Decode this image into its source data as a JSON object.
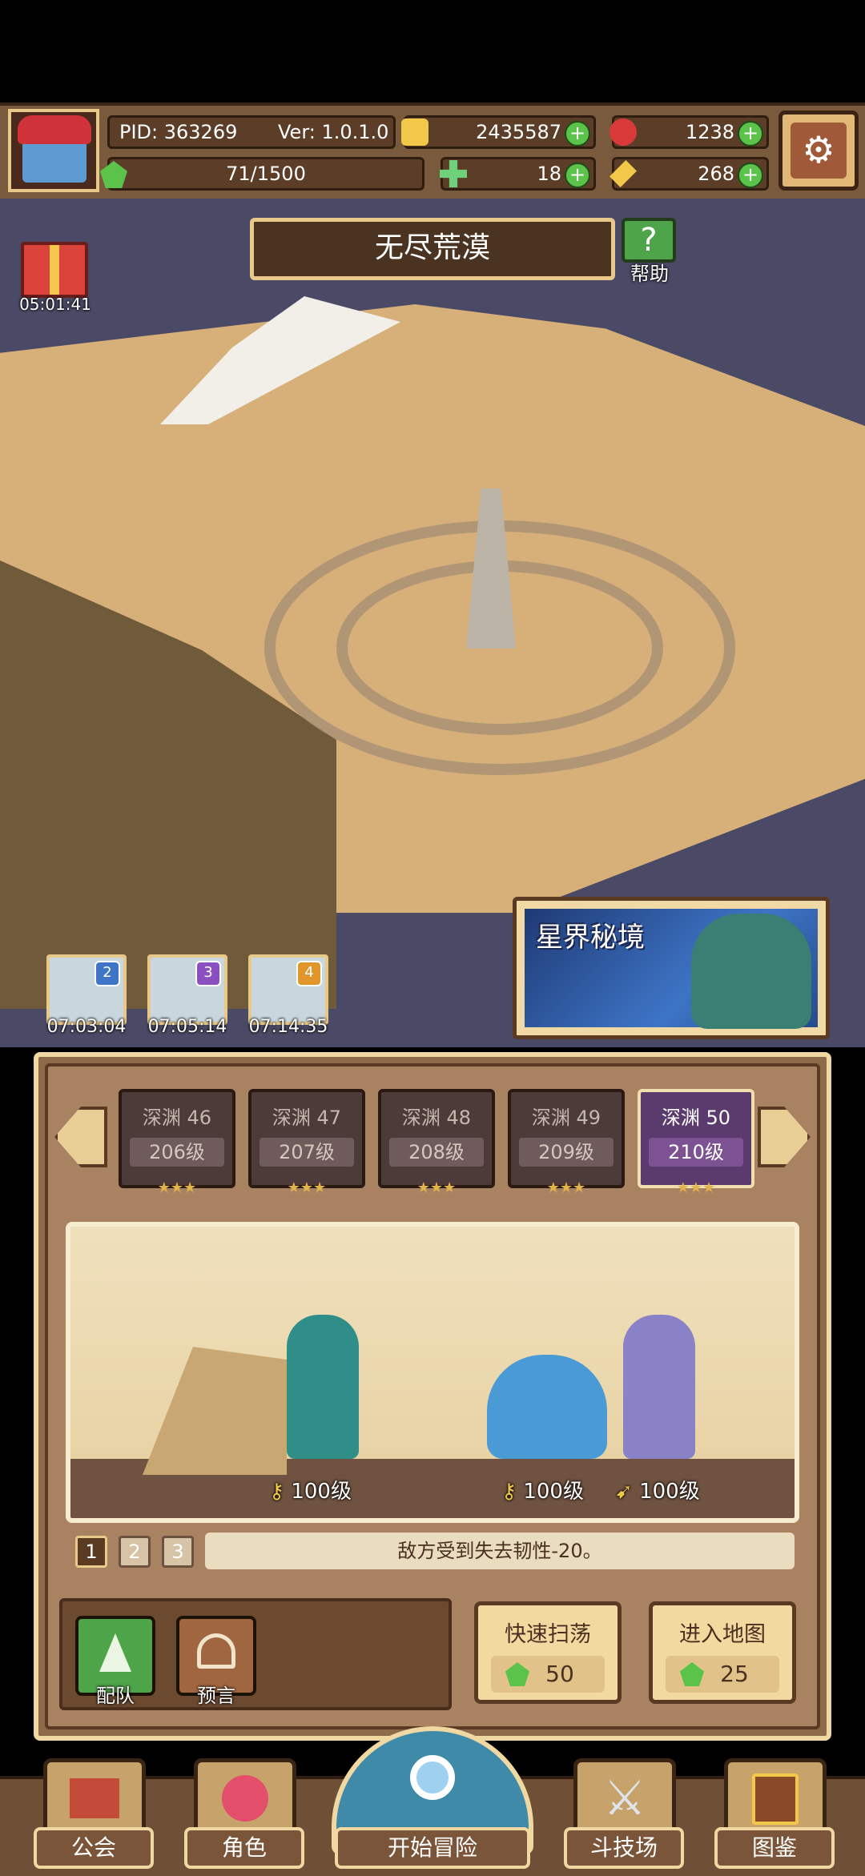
{
  "header": {
    "pid": "PID: 363269",
    "version": "Ver: 1.0.1.0",
    "gold": "2435587",
    "ruby": "1238",
    "stamina": "71/1500",
    "clover": "18",
    "key": "268"
  },
  "map": {
    "title": "无尽荒漠",
    "help_label": "帮助",
    "gift_timer": "05:01:41"
  },
  "expedition_slots": [
    {
      "num": "2",
      "time": "07:03:04"
    },
    {
      "num": "3",
      "time": "07:05:14"
    },
    {
      "num": "4",
      "time": "07:14:35"
    }
  ],
  "astral": {
    "label": "星界秘境"
  },
  "stages": [
    {
      "name": "深渊 46",
      "level": "206级",
      "stars": "★★★"
    },
    {
      "name": "深渊 47",
      "level": "207级",
      "stars": "★★★"
    },
    {
      "name": "深渊 48",
      "level": "208级",
      "stars": "★★★"
    },
    {
      "name": "深渊 49",
      "level": "209级",
      "stars": "★★★"
    },
    {
      "name": "深渊 50",
      "level": "210级",
      "stars": "★★★"
    }
  ],
  "battle": {
    "ally_level": "100级",
    "enemy_level_1": "100级",
    "enemy_level_2": "100级"
  },
  "effect": {
    "tabs": [
      "1",
      "2",
      "3"
    ],
    "text": "敌方受到失去韧性-20。"
  },
  "actions": {
    "team_label": "配队",
    "prophecy_label": "预言",
    "sweep": {
      "title": "快速扫荡",
      "cost": "50"
    },
    "enter": {
      "title": "进入地图",
      "cost": "25"
    }
  },
  "nav": {
    "guild": "公会",
    "character": "角色",
    "start": "开始冒险",
    "arena": "斗技场",
    "codex": "图鉴"
  },
  "colors": {
    "wood": "#7a5a3c",
    "panel": "#a98262",
    "accent_green": "#5bc24a",
    "selected_stage": "#5b3a6e"
  }
}
